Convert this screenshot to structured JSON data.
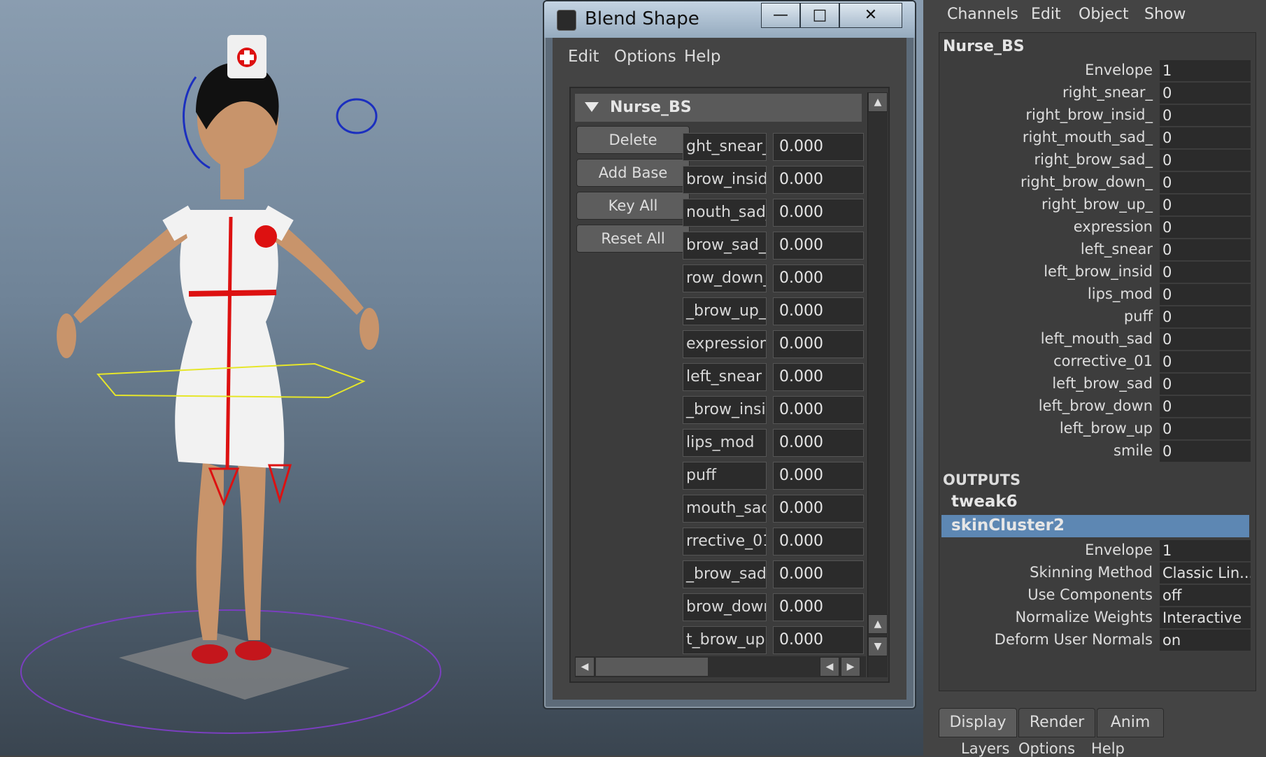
{
  "blend_window": {
    "title": "Blend Shape",
    "menu": [
      "Edit",
      "Options",
      "Help"
    ],
    "node_name": "Nurse_BS",
    "buttons": [
      "Delete",
      "Add Base",
      "Key All",
      "Reset All"
    ],
    "targets": [
      {
        "name": "ght_snear_",
        "value": "0.000"
      },
      {
        "name": "brow_insid_",
        "value": "0.000"
      },
      {
        "name": "nouth_sad_",
        "value": "0.000"
      },
      {
        "name": "brow_sad_",
        "value": "0.000"
      },
      {
        "name": "row_down_",
        "value": "0.000"
      },
      {
        "name": "_brow_up_",
        "value": "0.000"
      },
      {
        "name": "expression",
        "value": "0.000"
      },
      {
        "name": "left_snear",
        "value": "0.000"
      },
      {
        "name": "_brow_insid",
        "value": "0.000"
      },
      {
        "name": "lips_mod",
        "value": "0.000"
      },
      {
        "name": "puff",
        "value": "0.000"
      },
      {
        "name": "mouth_sad",
        "value": "0.000"
      },
      {
        "name": "rrective_01",
        "value": "0.000"
      },
      {
        "name": "_brow_sad",
        "value": "0.000"
      },
      {
        "name": "brow_down",
        "value": "0.000"
      },
      {
        "name": "t_brow_up",
        "value": "0.000"
      }
    ]
  },
  "channel_box": {
    "menu": [
      "Channels",
      "Edit",
      "Object",
      "Show"
    ],
    "node": "Nurse_BS",
    "attributes": [
      {
        "label": "Envelope",
        "value": "1"
      },
      {
        "label": "right_snear_",
        "value": "0"
      },
      {
        "label": "right_brow_insid_",
        "value": "0"
      },
      {
        "label": "right_mouth_sad_",
        "value": "0"
      },
      {
        "label": "right_brow_sad_",
        "value": "0"
      },
      {
        "label": "right_brow_down_",
        "value": "0"
      },
      {
        "label": "right_brow_up_",
        "value": "0"
      },
      {
        "label": "expression",
        "value": "0"
      },
      {
        "label": "left_snear",
        "value": "0"
      },
      {
        "label": "left_brow_insid",
        "value": "0"
      },
      {
        "label": "lips_mod",
        "value": "0"
      },
      {
        "label": "puff",
        "value": "0"
      },
      {
        "label": "left_mouth_sad",
        "value": "0"
      },
      {
        "label": "corrective_01",
        "value": "0"
      },
      {
        "label": "left_brow_sad",
        "value": "0"
      },
      {
        "label": "left_brow_down",
        "value": "0"
      },
      {
        "label": "left_brow_up",
        "value": "0"
      },
      {
        "label": "smile",
        "value": "0"
      }
    ],
    "outputs_label": "OUTPUTS",
    "outputs": [
      "tweak6",
      "skinCluster2"
    ],
    "skin_attributes": [
      {
        "label": "Envelope",
        "value": "1"
      },
      {
        "label": "Skinning Method",
        "value": "Classic Lin..."
      },
      {
        "label": "Use Components",
        "value": "off"
      },
      {
        "label": "Normalize Weights",
        "value": "Interactive"
      },
      {
        "label": "Deform User Normals",
        "value": "on"
      }
    ],
    "tabs": [
      "Display",
      "Render",
      "Anim"
    ],
    "sub_menu": [
      "Layers",
      "Options",
      "Help"
    ]
  },
  "colors": {
    "selection": "#5d87b3",
    "panel": "#444444",
    "field": "#2b2b2b"
  }
}
